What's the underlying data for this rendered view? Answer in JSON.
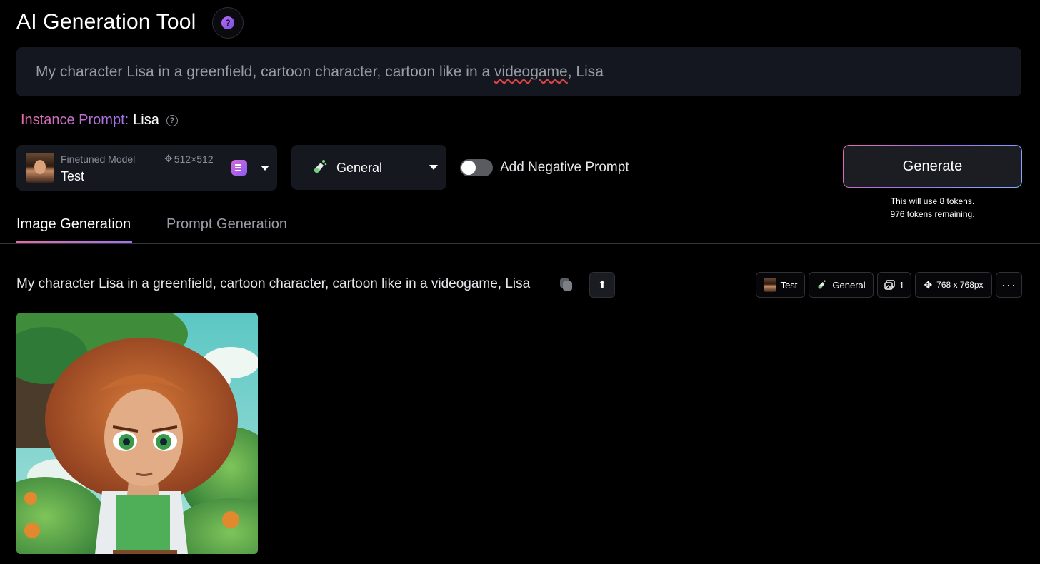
{
  "header": {
    "title": "AI Generation Tool",
    "help_glyph": "?"
  },
  "prompt": {
    "text_before": "My character Lisa in a greenfield, cartoon character, cartoon like in a ",
    "text_misspelled": "videogame",
    "text_after": ", Lisa"
  },
  "instance_prompt": {
    "label": "Instance Prompt:",
    "value": "Lisa"
  },
  "model": {
    "caption": "Finetuned Model",
    "size": "512×512",
    "name": "Test"
  },
  "style": {
    "label": "General",
    "icon": "flask-icon"
  },
  "negative_prompt": {
    "label": "Add Negative Prompt",
    "enabled": false
  },
  "generate": {
    "label": "Generate",
    "token_line1": "This will use 8 tokens.",
    "token_line2": "976 tokens remaining."
  },
  "tabs": [
    {
      "label": "Image Generation",
      "active": true
    },
    {
      "label": "Prompt Generation",
      "active": false
    }
  ],
  "result": {
    "prompt": "My character Lisa in a greenfield, cartoon character, cartoon like in a videogame, Lisa",
    "chips": {
      "model": "Test",
      "style": "General",
      "count": "1",
      "size": "768 x 768px",
      "more": "···"
    }
  },
  "colors": {
    "accent_pink": "#e86aa8",
    "accent_purple": "#9e74f0",
    "panel": "#161820"
  }
}
